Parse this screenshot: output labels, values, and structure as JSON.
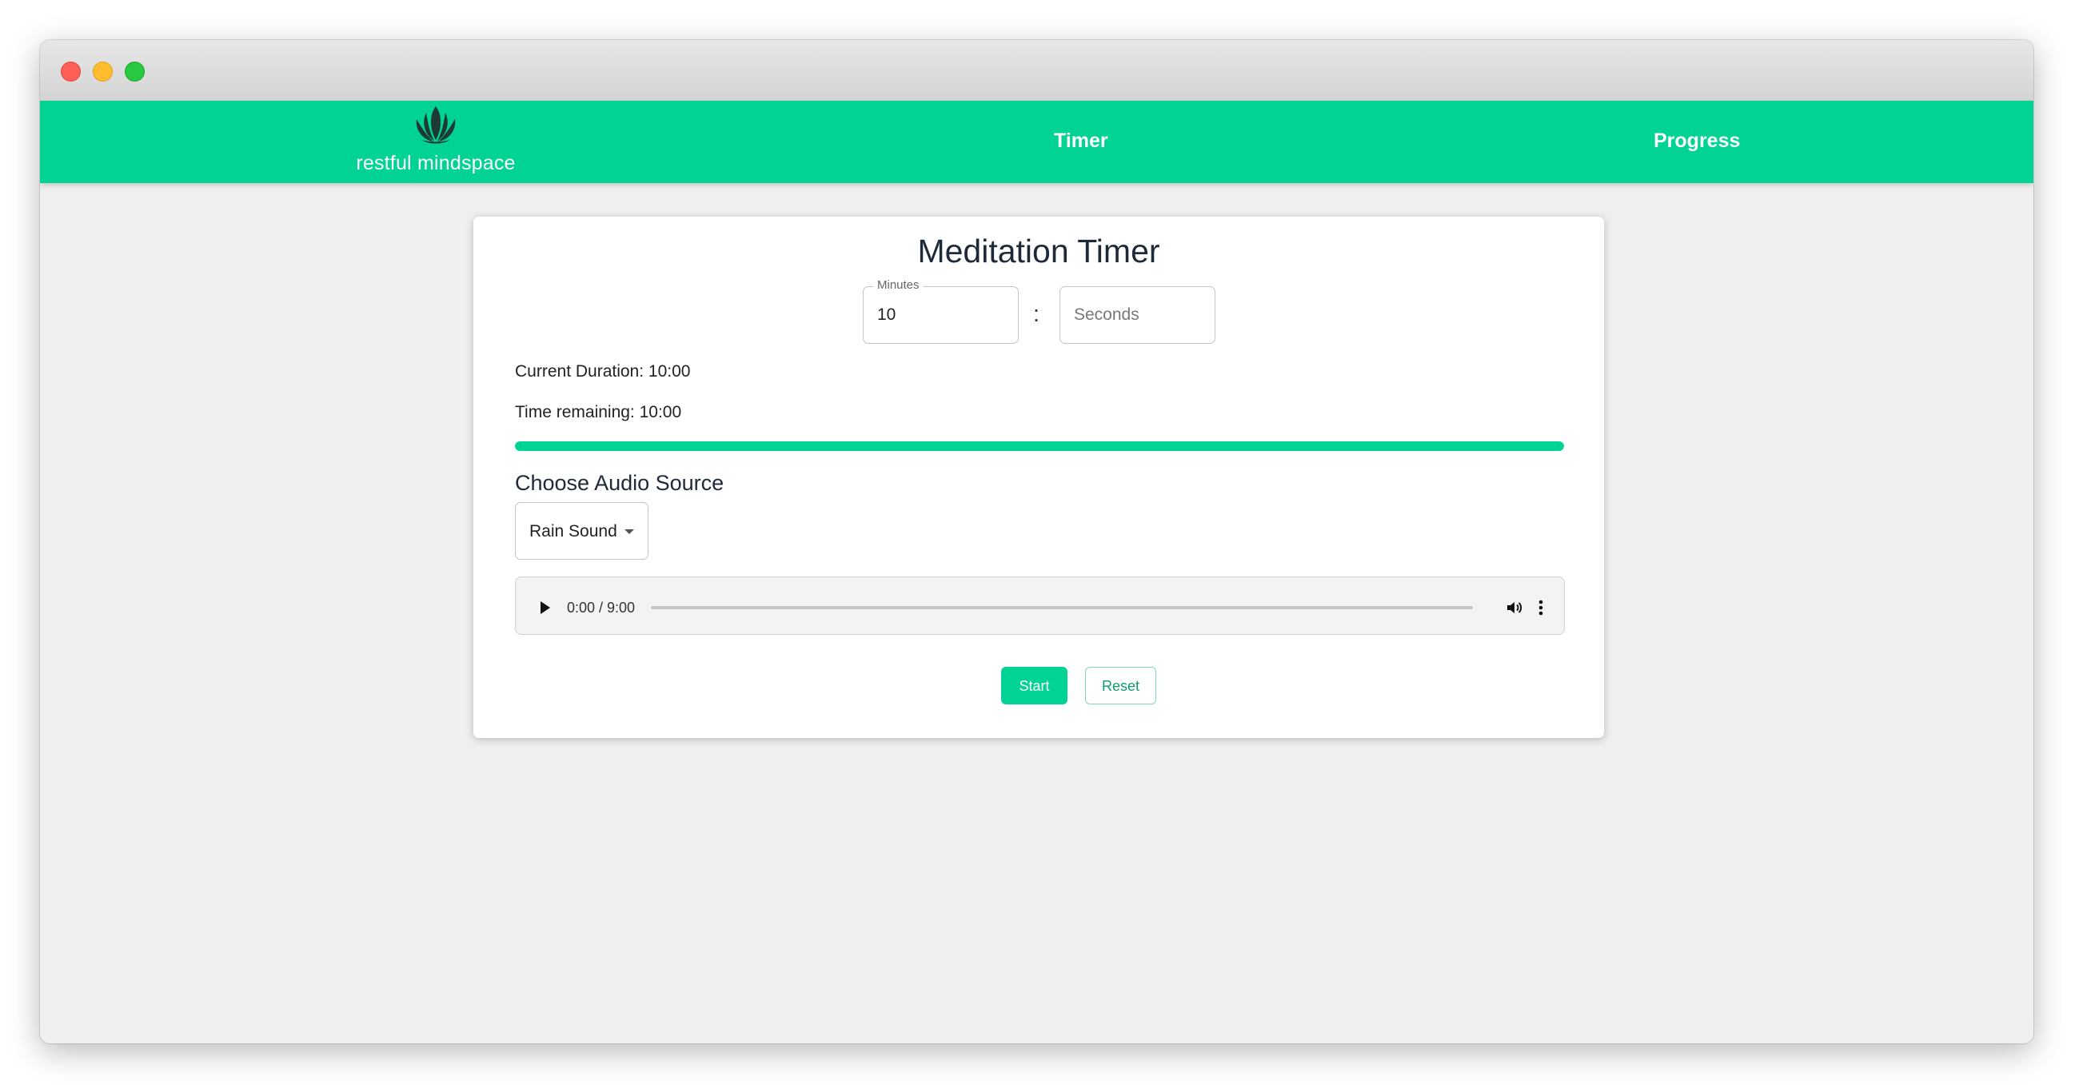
{
  "app": {
    "brand_name": "restful mindspace",
    "logo_icon": "lotus-icon",
    "accent_color": "#00d394"
  },
  "nav": {
    "timer_label": "Timer",
    "progress_label": "Progress"
  },
  "timer": {
    "title": "Meditation Timer",
    "minutes_label": "Minutes",
    "minutes_value": "10",
    "seconds_placeholder": "Seconds",
    "separator": ":",
    "current_duration_text": "Current Duration: 10:00",
    "time_remaining_text": "Time remaining: 10:00",
    "progress_fraction": 1.0
  },
  "audio": {
    "heading": "Choose Audio Source",
    "selected_source": "Rain Sound",
    "player_time": "0:00 / 9:00",
    "icons": [
      "play-icon",
      "volume-icon",
      "more-options-icon"
    ]
  },
  "actions": {
    "start_label": "Start",
    "reset_label": "Reset"
  }
}
